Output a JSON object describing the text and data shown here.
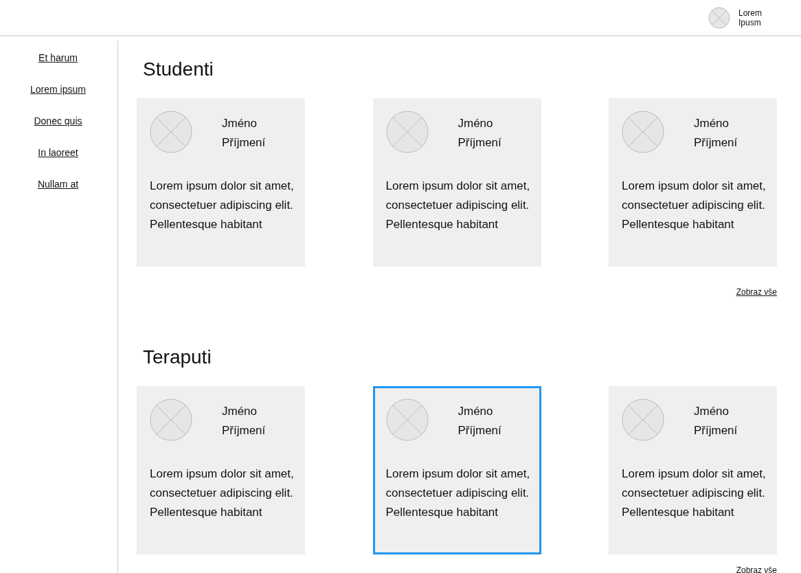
{
  "header": {
    "user_name": "Lorem\nIpusm"
  },
  "sidebar": {
    "items": [
      {
        "label": "Et harum"
      },
      {
        "label": "Lorem ipsum"
      },
      {
        "label": "Donec quis"
      },
      {
        "label": "In laoreet"
      },
      {
        "label": "Nullam at"
      }
    ]
  },
  "sections": [
    {
      "title": "Studenti",
      "cards": [
        {
          "first_name": "Jméno",
          "last_name": "Příjmení",
          "text": "Lorem ipsum dolor sit amet, consectetuer adipiscing elit. Pellentesque habitant",
          "selected": false
        },
        {
          "first_name": "Jméno",
          "last_name": "Příjmení",
          "text": "Lorem ipsum dolor sit amet, consectetuer adipiscing elit. Pellentesque habitant",
          "selected": false
        },
        {
          "first_name": "Jméno",
          "last_name": "Příjmení",
          "text": "Lorem ipsum dolor sit amet, consectetuer adipiscing elit. Pellentesque habitant",
          "selected": false
        }
      ],
      "link": "Zobraz vše"
    },
    {
      "title": "Teraputi",
      "cards": [
        {
          "first_name": "Jméno",
          "last_name": "Příjmení",
          "text": "Lorem ipsum dolor sit amet, consectetuer adipiscing elit. Pellentesque habitant",
          "selected": false
        },
        {
          "first_name": "Jméno",
          "last_name": "Příjmení",
          "text": "Lorem ipsum dolor sit amet, consectetuer adipiscing elit. Pellentesque habitant",
          "selected": true
        },
        {
          "first_name": "Jméno",
          "last_name": "Příjmení",
          "text": "Lorem ipsum dolor sit amet, consectetuer adipiscing elit. Pellentesque habitant",
          "selected": false
        }
      ],
      "link": "Zobraz vše"
    }
  ]
}
